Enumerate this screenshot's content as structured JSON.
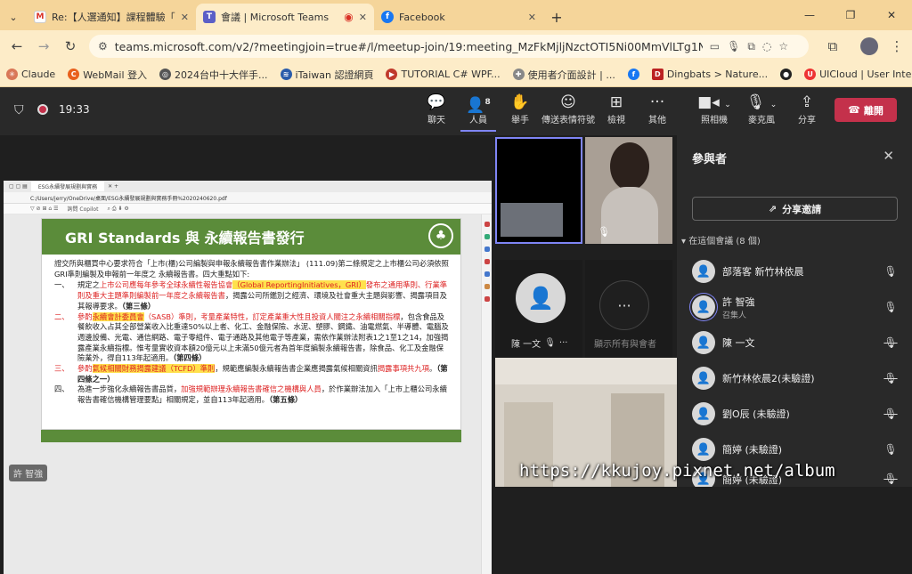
{
  "browser": {
    "tabs": [
      {
        "favicon": "gmail-icon",
        "title": "Re:【人選通知】課程體驗「ESG",
        "color": "#d93025"
      },
      {
        "favicon": "teams-icon",
        "title": "會議 | Microsoft Teams",
        "color": "#5b5fc7"
      },
      {
        "favicon": "facebook-icon",
        "title": "Facebook",
        "color": "#1877f2"
      }
    ],
    "url": "teams.microsoft.com/v2/?meetingjoin=true#/l/meetup-join/19:meeting_MzFkMjljNzctOTI5Ni00MmVlLTg1NjQtYTdiMW...",
    "bookmarks": [
      "Claude",
      "WebMail 登入",
      "2024台中十大伴手...",
      "iTaiwan 認證網頁",
      "TUTORIAL C# WPF...",
      "使用者介面設計 | ...",
      "",
      "Dingbats > Nature...",
      "",
      "UICloud | User Inte..."
    ]
  },
  "teams_bar": {
    "time": "19:33",
    "chat": "聊天",
    "people": "人員",
    "people_count": "8",
    "raise": "舉手",
    "react": "傳送表情符號",
    "view": "檢視",
    "more": "其他",
    "camera": "照相機",
    "mic": "麥克風",
    "share": "分享",
    "leave": "離開"
  },
  "shared_content": {
    "pdf_tab": "ESG永續發展規劃與實務",
    "pdf_path": "C:/Users/jerry/OneDrive/桌面/ESG永續發展規劃與實務手冊%2020240620.pdf",
    "copilot": "詢問 Copilot",
    "heading": "GRI Standards 與 永續報告書發行",
    "intro": "證交所與櫃買中心要求符合「上市(櫃)公司編製與申報永續報告書作業辦法」 (111.09)第二條規定之上市櫃公司必須依照GRI準則編製及申報前一年度之 永續報告書。四大重點如下:",
    "items": [
      {
        "num": "一、",
        "parts": [
          "規定之",
          "上市公司應每年參考全球永續性報告協會",
          "（Global ReportingInitiatives，GRI）",
          "發布之通用準則、行業準則及重大主題準則編製前一年度之永續報告書",
          "，揭露公司所鑑別之經濟、環境及社會重大主題與影響、揭露項目及其報導要求。",
          "（第三條）"
        ]
      },
      {
        "num": "二、",
        "parts": [
          "參酌",
          "永續會計委員會",
          "（SASB）",
          "準則",
          "，考量產業特性，訂定產業重大性且投資人關注之永續相關指標",
          "，包含食品及餐飲收入占其全部營業收入比重達50%以上者、化工、金融保險、水泥、塑膠、鋼鐵、油電燃氣、半導體、電腦及週邊設備、光電、通信網路、電子零組件、電子通路及其他電子等產業，需依作業辦法附表1之1至1之14，加強揭露產業永續指標。惟考量實收資本額20億元以上未滿50億元者為首年度編製永續報告書，除食品、化工及金融保險業外，得自113年起適用。",
          "（第四條）"
        ]
      },
      {
        "num": "三、",
        "parts": [
          "參酌",
          "氣候相關財務揭露建議（TCFD）準則",
          "，規範應編製永續報告書企業應揭露氣候相關資訊",
          "揭露事項共九項",
          "。",
          "（第四條之一）"
        ]
      },
      {
        "num": "四、",
        "parts": [
          "為進一步強化永續報告書品質，",
          "加強規範辦理永續報告書確信之機構與人員",
          "，於作業辦法加入「上市上櫃公司永續報告書確信機構管理要點」相關規定，並自113年起適用。",
          "（第五條）"
        ]
      }
    ],
    "presenter": "許 智強"
  },
  "gallery": {
    "tile1_name": "陳 一文",
    "tile2_label": "顯示所有與會者"
  },
  "participants": {
    "title": "參與者",
    "share_invite": "分享邀請",
    "section": "在這個會議 (8 個)",
    "people": [
      {
        "name": "部落客 新竹林依晨",
        "role": "",
        "mic": "on"
      },
      {
        "name": "許 智強",
        "role": "召集人",
        "mic": "on"
      },
      {
        "name": "陳 一文",
        "role": "",
        "mic": "off"
      },
      {
        "name": "新竹林依晨2(未驗證)",
        "role": "",
        "mic": "off"
      },
      {
        "name": "劉O辰 (未驗證)",
        "role": "",
        "mic": "off"
      },
      {
        "name": "簡婷 (未驗證)",
        "role": "",
        "mic": "on"
      },
      {
        "name": "簡婷 (未驗證)",
        "role": "",
        "mic": "off"
      }
    ]
  },
  "watermark": "https://kkujoy.pixnet.net/album"
}
